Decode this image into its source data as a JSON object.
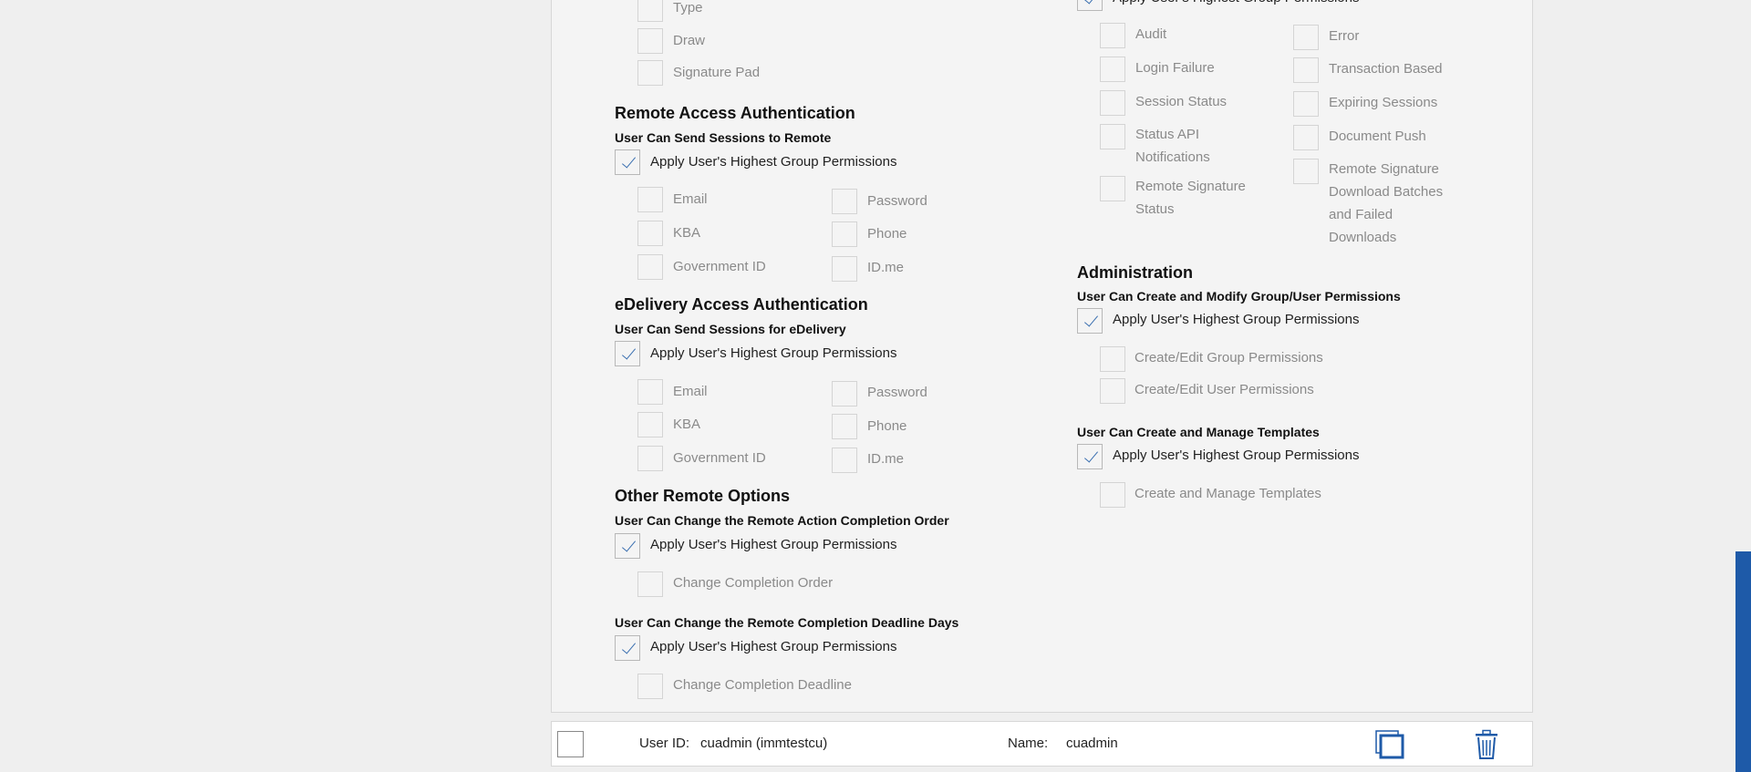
{
  "signature_methods": {
    "items": [
      "Type",
      "Draw",
      "Signature Pad"
    ]
  },
  "remote_access": {
    "title": "Remote Access Authentication",
    "subtitle": "User Can Send Sessions to Remote",
    "apply_label": "Apply User's Highest Group Permissions",
    "left_options": [
      "Email",
      "KBA",
      "Government ID"
    ],
    "right_options": [
      "Password",
      "Phone",
      "ID.me"
    ]
  },
  "edelivery": {
    "title": "eDelivery Access Authentication",
    "subtitle": "User Can Send Sessions for eDelivery",
    "apply_label": "Apply User's Highest Group Permissions",
    "left_options": [
      "Email",
      "KBA",
      "Government ID"
    ],
    "right_options": [
      "Password",
      "Phone",
      "ID.me"
    ]
  },
  "other_remote": {
    "title": "Other Remote Options",
    "completion_order": {
      "subtitle": "User Can Change the Remote Action Completion Order",
      "apply_label": "Apply User's Highest Group Permissions",
      "option": "Change Completion Order"
    },
    "completion_deadline": {
      "subtitle": "User Can Change the Remote Completion Deadline Days",
      "apply_label": "Apply User's Highest Group Permissions",
      "option": "Change Completion Deadline"
    }
  },
  "notifications": {
    "apply_label": "Apply User's Highest Group Permissions",
    "left_options": [
      "Audit",
      "Login Failure",
      "Session Status",
      "Status API Notifications",
      "Remote Signature Status"
    ],
    "right_options": [
      "Error",
      "Transaction Based",
      "Expiring Sessions",
      "Document Push",
      "Remote Signature Download Batches and Failed Downloads"
    ]
  },
  "administration": {
    "title": "Administration",
    "permissions": {
      "subtitle": "User Can Create and Modify Group/User Permissions",
      "apply_label": "Apply User's Highest Group Permissions",
      "options": [
        "Create/Edit Group Permissions",
        "Create/Edit User Permissions"
      ]
    },
    "templates": {
      "subtitle": "User Can Create and Manage Templates",
      "apply_label": "Apply User's Highest Group Permissions",
      "options": [
        "Create and Manage Templates"
      ]
    }
  },
  "footer": {
    "user_id_label": "User ID:",
    "user_id_value": "cuadmin (immtestcu)",
    "name_label": "Name:",
    "name_value": "cuadmin",
    "copy_icon": "copy-icon",
    "delete_icon": "trash-icon"
  },
  "colors": {
    "accent": "#1e5aa8",
    "check": "#3a6fb0",
    "muted_text": "#8a8a8a"
  }
}
